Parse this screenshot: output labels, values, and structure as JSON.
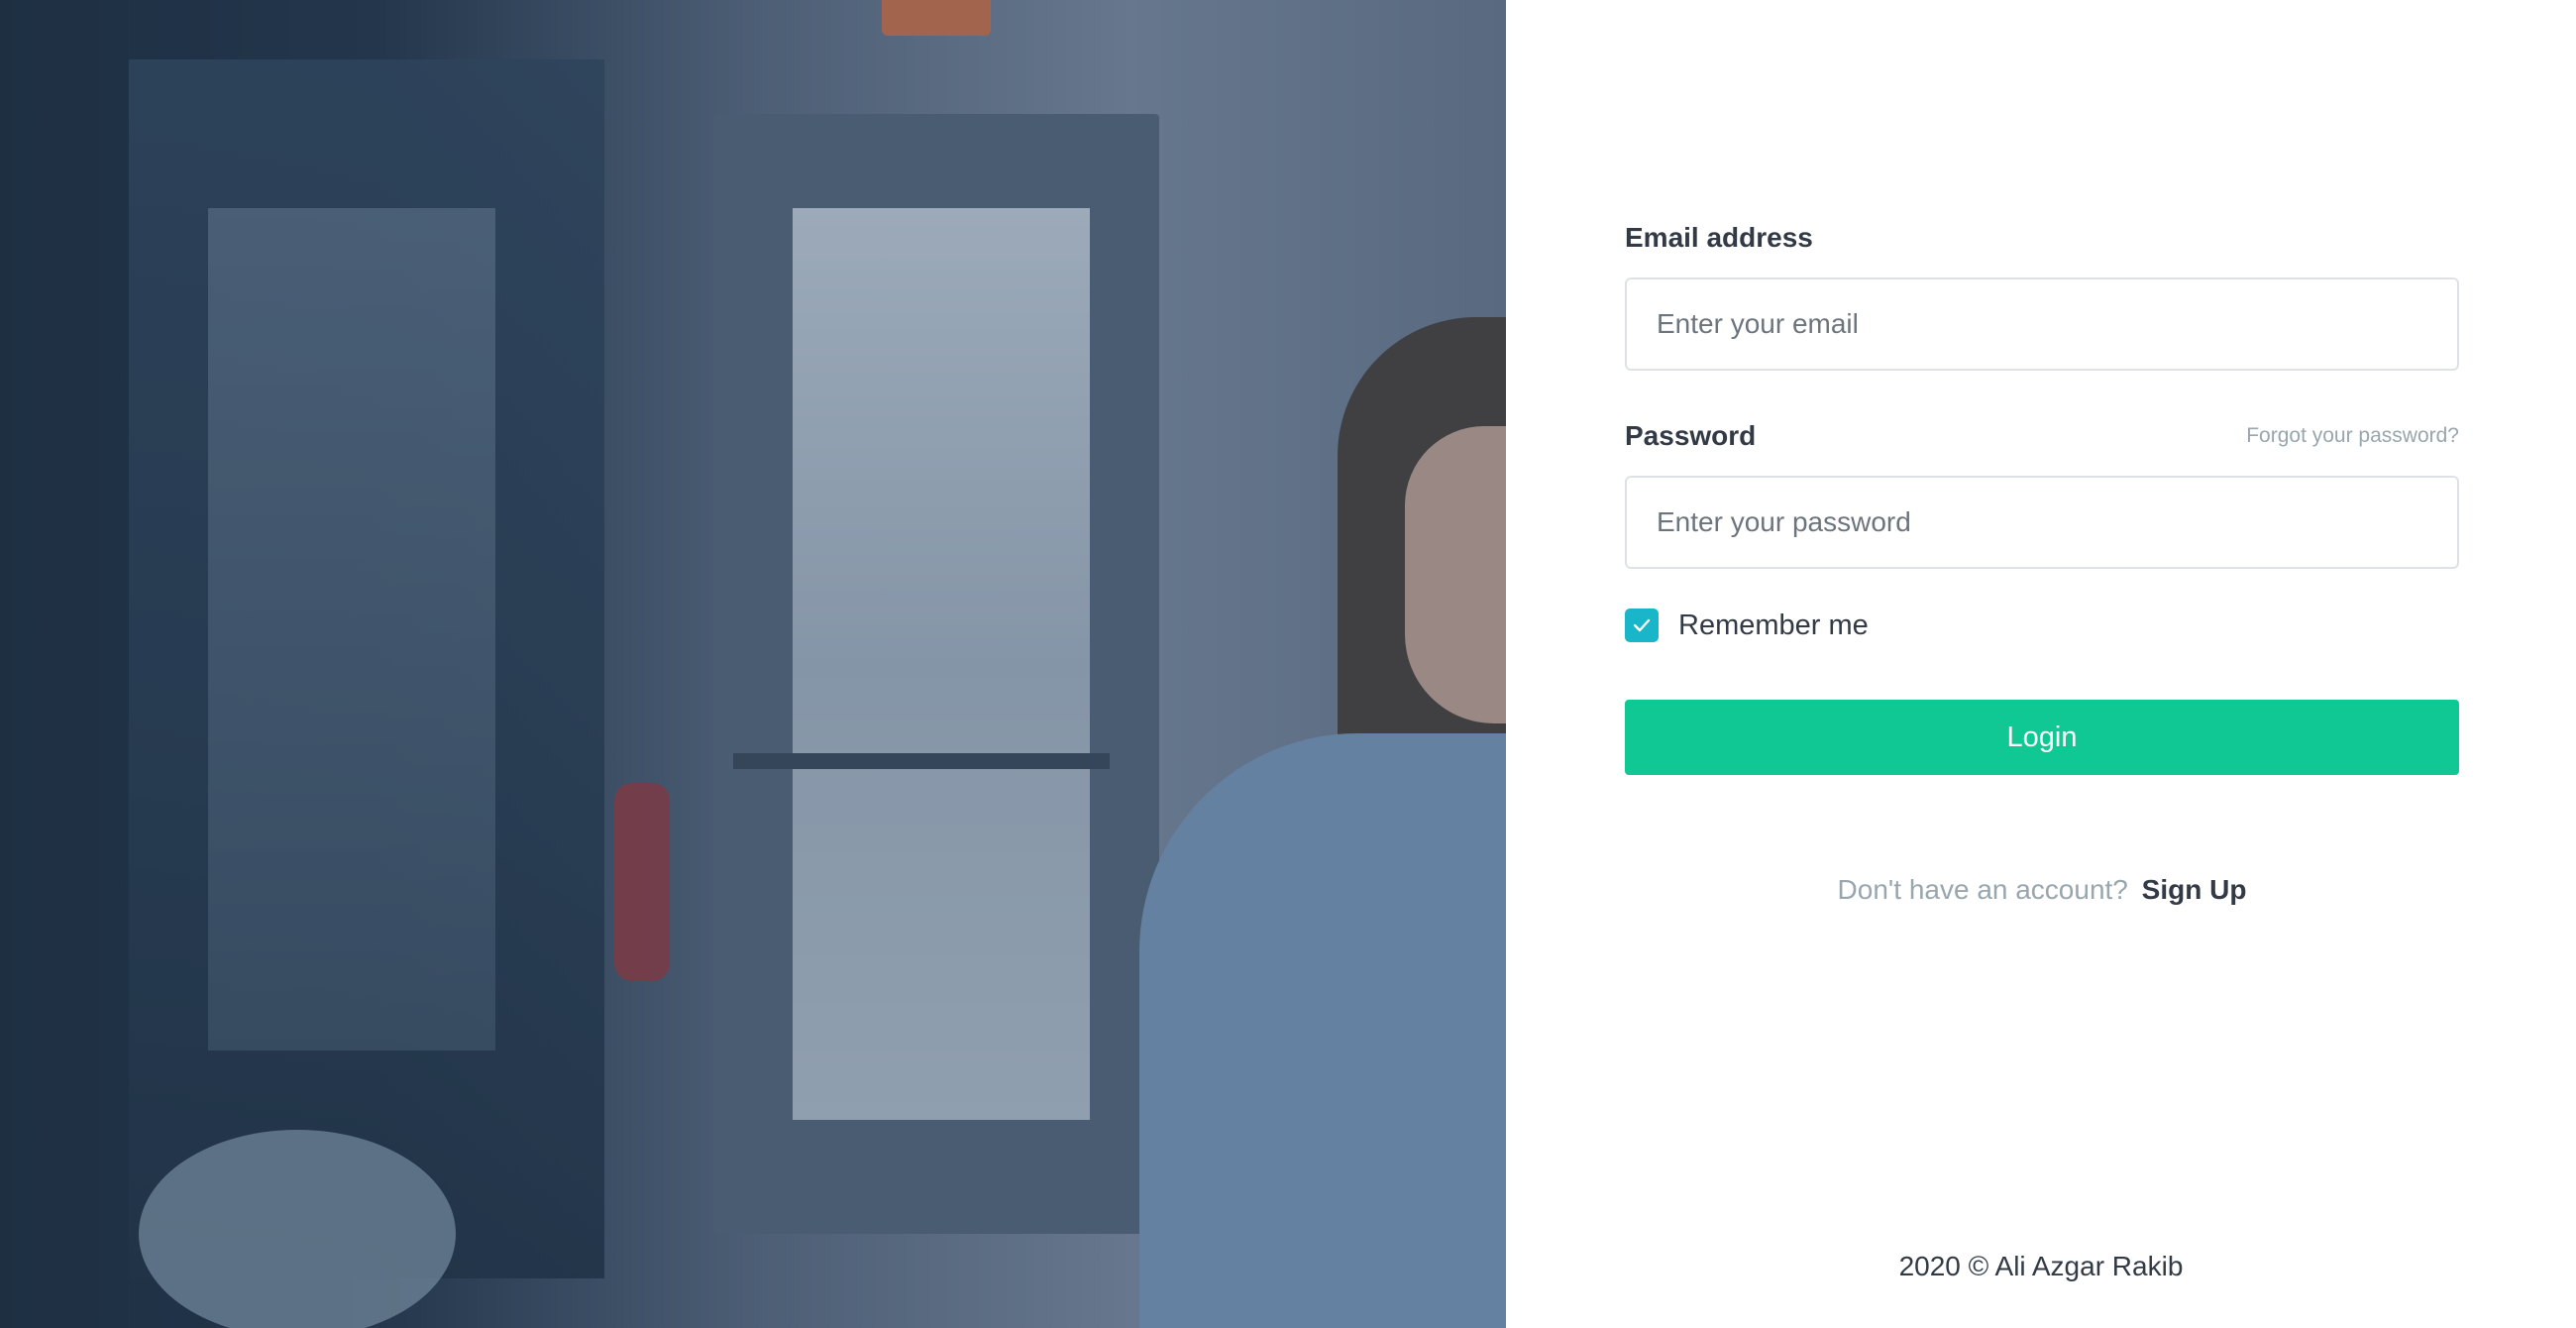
{
  "form": {
    "email_label": "Email address",
    "email_placeholder": "Enter your email",
    "password_label": "Password",
    "forgot_link": "Forgot your password?",
    "password_placeholder": "Enter your password",
    "remember_label": "Remember me",
    "remember_checked": true,
    "login_button": "Login"
  },
  "signup": {
    "prompt": "Don't have an account?",
    "link": "Sign Up"
  },
  "footer": {
    "copyright": "2020 © Ali Azgar Rakib"
  },
  "colors": {
    "primary_button": "#10c894",
    "checkbox": "#19b5c9",
    "text_dark": "#323a46",
    "text_muted": "#98a6ad"
  }
}
